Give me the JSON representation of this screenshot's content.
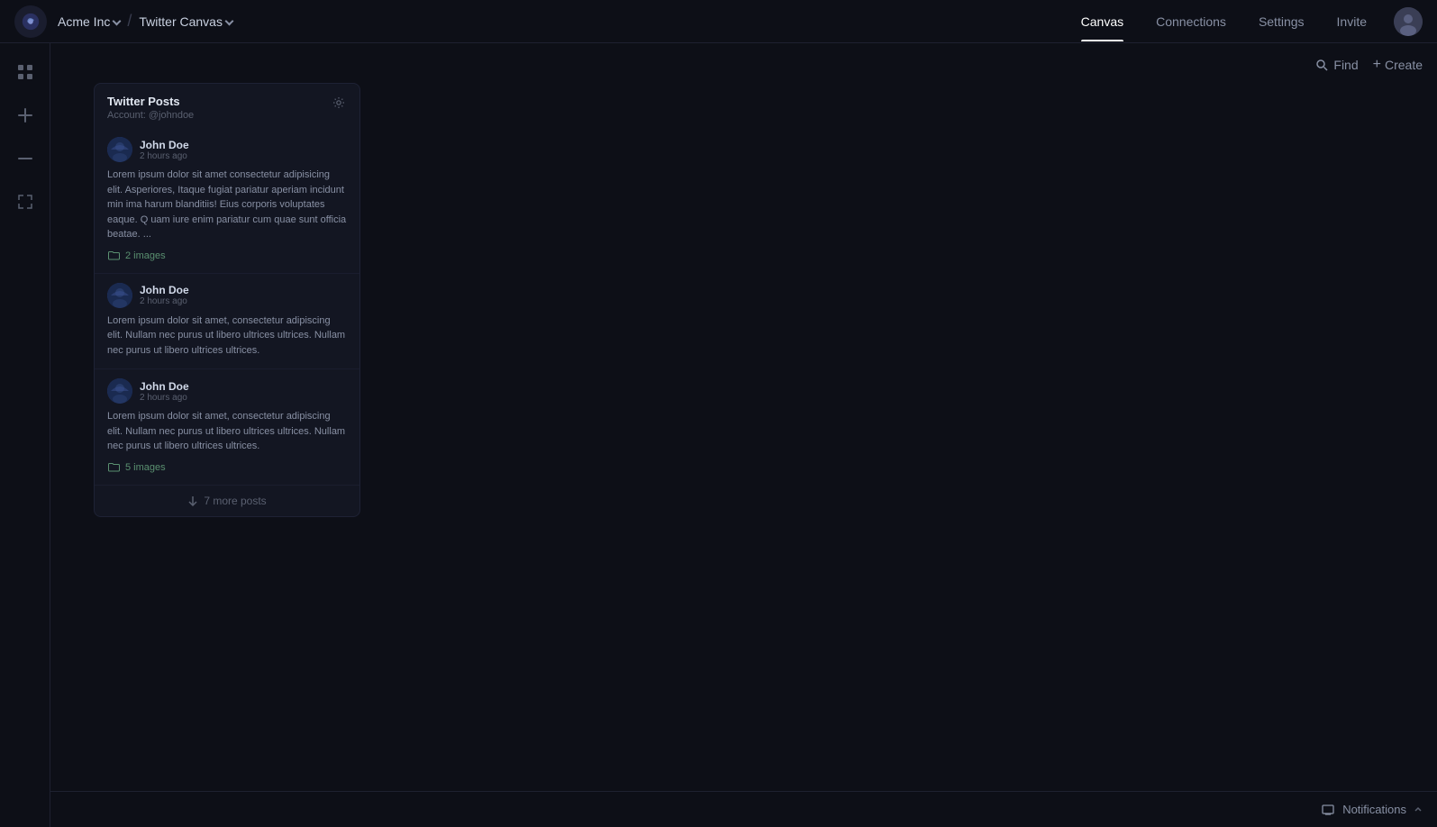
{
  "topnav": {
    "brand": "Acme Inc",
    "brand_chevron": "chevron-down",
    "canvas_title": "Twitter Canvas",
    "canvas_chevron": "chevron-down",
    "nav_items": [
      {
        "label": "Canvas",
        "active": true
      },
      {
        "label": "Connections",
        "active": false
      },
      {
        "label": "Settings",
        "active": false
      }
    ],
    "invite_label": "Invite"
  },
  "toolbar": {
    "find_label": "Find",
    "create_label": "Create"
  },
  "sidebar": {
    "icons": [
      {
        "name": "grid-icon",
        "symbol": "⊞"
      },
      {
        "name": "add-icon",
        "symbol": "+"
      },
      {
        "name": "minus-icon",
        "symbol": "−"
      },
      {
        "name": "expand-icon",
        "symbol": "⤢"
      }
    ]
  },
  "widget": {
    "title": "Twitter Posts",
    "account": "Account: @johndoe",
    "posts": [
      {
        "name": "John Doe",
        "time": "2 hours ago",
        "text": "Lorem ipsum dolor sit amet consectetur adipisicing elit. Asperiores, Itaque fugiat pariatur aperiam incidunt min ima harum blanditiis! Eius corporis voluptates eaque. Q uam iure enim pariatur cum quae sunt officia beatae. ...",
        "images_label": "2 images",
        "has_images": true
      },
      {
        "name": "John Doe",
        "time": "2 hours ago",
        "text": "Lorem ipsum dolor sit amet, consectetur adipiscing elit. Nullam nec purus ut libero ultrices ultrices. Nullam nec purus ut libero ultrices ultrices.",
        "has_images": false
      },
      {
        "name": "John Doe",
        "time": "2 hours ago",
        "text": "Lorem ipsum dolor sit amet, consectetur adipiscing elit. Nullam nec purus ut libero ultrices ultrices. Nullam nec purus ut libero ultrices ultrices.",
        "images_label": "5 images",
        "has_images": true
      }
    ],
    "more_posts_label": "7 more posts"
  },
  "notifications": {
    "label": "Notifications"
  }
}
